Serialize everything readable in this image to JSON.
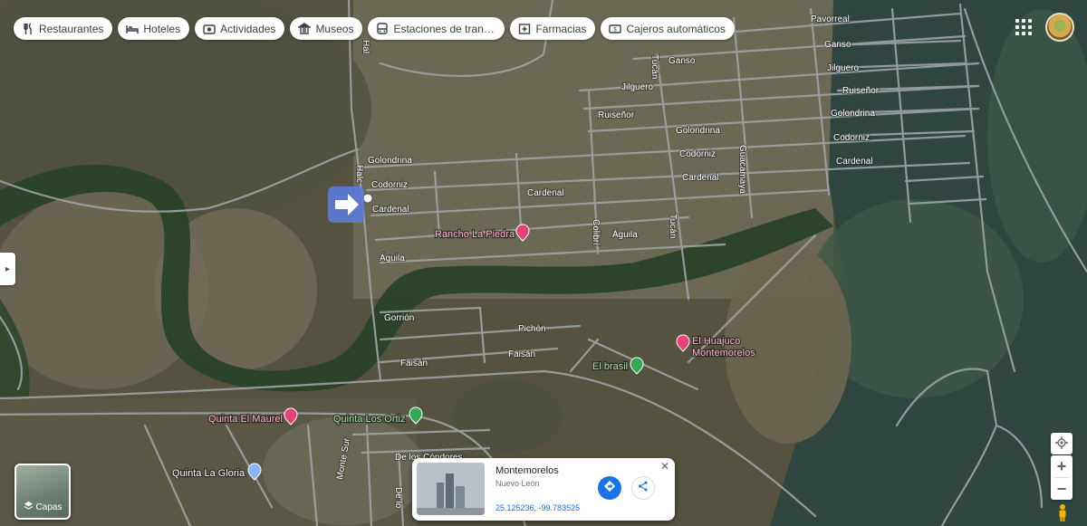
{
  "categories": [
    {
      "label": "Restaurantes",
      "icon": "fork-knife-icon"
    },
    {
      "label": "Hoteles",
      "icon": "bed-icon"
    },
    {
      "label": "Actividades",
      "icon": "camera-icon"
    },
    {
      "label": "Museos",
      "icon": "museum-icon"
    },
    {
      "label": "Estaciones de transp…",
      "icon": "bus-icon"
    },
    {
      "label": "Farmacias",
      "icon": "pharmacy-icon"
    },
    {
      "label": "Cajeros automáticos",
      "icon": "atm-icon"
    }
  ],
  "map": {
    "streets": {
      "pavorreal": "Pavorreal",
      "ganso": "Ganso",
      "ganso2": "Ganso",
      "jilguero": "Jilguero",
      "jilguero2": "Jilguero",
      "ruisenor": "Ruiseñor",
      "ruisenor2": "Ruiseñor",
      "golondrina": "Golondrina",
      "golondrina2": "Golondrina",
      "golondrina3": "Golondrina",
      "codorniz": "Codorniz",
      "codorniz2": "Codorniz",
      "codorniz3": "Codorniz",
      "cardenal": "Cardenal",
      "cardenal2": "Cardenal",
      "cardenal3": "Cardenal",
      "cardenal4": "Cardenal",
      "aguila": "Águila",
      "aguila2": "Águila",
      "tucan": "Tucán",
      "tucan2": "Tucán",
      "guacamaya": "Guacamaya",
      "colibri": "Colibrí",
      "hal": "Hal",
      "halc": "Halc",
      "gorrion": "Gorrión",
      "pichon": "Pichón",
      "faisan": "Faisán",
      "faisan2": "Faisán",
      "condores": "De los Cóndores",
      "condores2": "De lo",
      "montesur": "Monte Sur"
    },
    "places": [
      {
        "name": "Rancho La Piedra",
        "type": "hotel",
        "color": "#e8417a"
      },
      {
        "name": "El Huajuco",
        "name2": "Montemorelos",
        "type": "hotel",
        "color": "#e8417a"
      },
      {
        "name": "El brasil",
        "type": "park",
        "color": "#34a853"
      },
      {
        "name": "Quinta El Maurel",
        "type": "hotel",
        "color": "#e8417a"
      },
      {
        "name": "Quinta Los Ortiz",
        "type": "park",
        "color": "#34a853"
      },
      {
        "name": "Quinta La Gloria",
        "type": "place",
        "color": "#8ab4f8"
      }
    ]
  },
  "layers": {
    "label": "Capas"
  },
  "card": {
    "title": "Montemorelos",
    "subtitle": "Nuevo León",
    "coords": "25.125236, -99.783525",
    "close": "✕"
  }
}
